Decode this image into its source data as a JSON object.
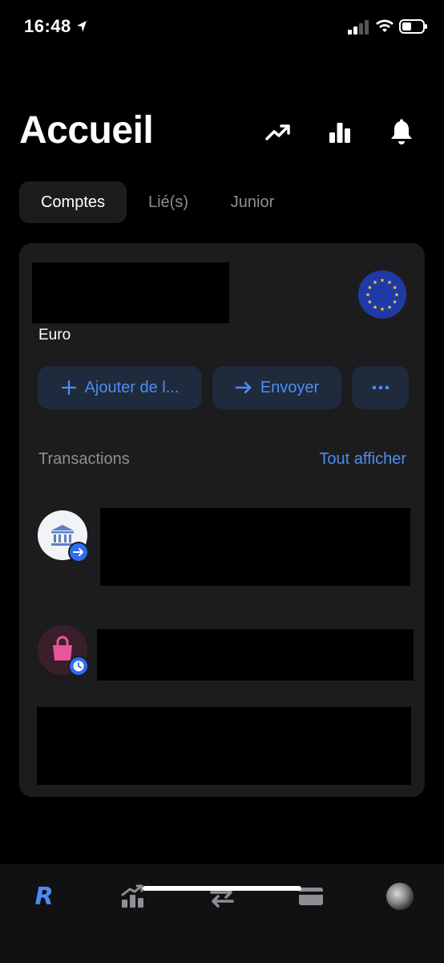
{
  "status_bar": {
    "time": "16:48",
    "icons": [
      "location-arrow-icon",
      "signal-icon",
      "wifi-icon",
      "battery-icon"
    ]
  },
  "header": {
    "title": "Accueil",
    "icons": [
      "trend-up-icon",
      "bar-chart-icon",
      "bell-icon"
    ]
  },
  "tabs": [
    {
      "label": "Comptes",
      "active": true
    },
    {
      "label": "Lié(s)",
      "active": false
    },
    {
      "label": "Junior",
      "active": false
    }
  ],
  "account": {
    "currency": "Euro",
    "flag_icon": "eu-flag-icon",
    "actions": [
      {
        "label": "Ajouter de l...",
        "icon": "plus-icon"
      },
      {
        "label": "Envoyer",
        "icon": "arrow-right-icon"
      },
      {
        "label": "",
        "icon": "more-icon"
      }
    ]
  },
  "transactions": {
    "title": "Transactions",
    "see_all": "Tout afficher",
    "items": [
      {
        "icon": "bank-icon",
        "badge": "arrow-right-icon"
      },
      {
        "icon": "shopping-bag-icon",
        "badge": "clock-icon"
      }
    ]
  },
  "bottom_nav": {
    "logo_text": "R",
    "items": [
      "home-logo",
      "invest-icon",
      "transfer-icon",
      "card-icon",
      "profile-avatar"
    ]
  },
  "colors": {
    "accent": "#4c8df5",
    "background": "#000000",
    "card": "#1c1c1e",
    "muted": "#8e8e93"
  }
}
